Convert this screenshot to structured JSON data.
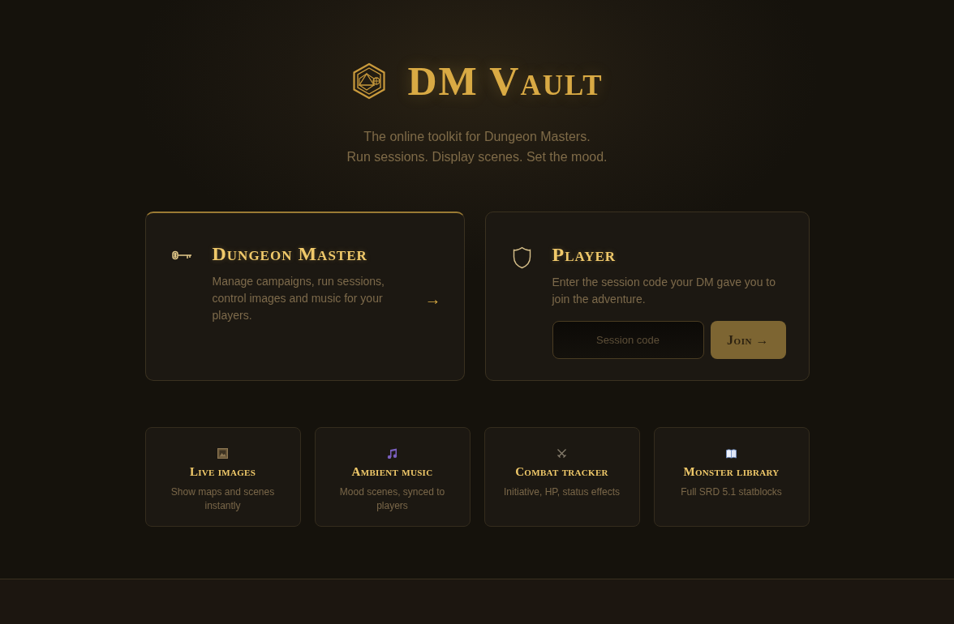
{
  "header": {
    "title": "DM Vault",
    "tagline": [
      "The online toolkit for Dungeon Masters.",
      "Run sessions. Display scenes. Set the mood."
    ]
  },
  "roles": [
    {
      "kind": "dm",
      "selected": true,
      "title": "Dungeon Master",
      "description": "Manage campaigns, run sessions, control images and music for your players.",
      "arrow": "→"
    },
    {
      "kind": "player",
      "selected": false,
      "title": "Player",
      "description": "Enter the session code your DM gave you to join the adventure.",
      "session_field": {
        "placeholder": "Session code"
      },
      "button": "Join →"
    }
  ],
  "features": [
    {
      "title": "Live images",
      "description": "Show maps and scenes instantly"
    },
    {
      "title": "Ambient music",
      "description": "Mood scenes, synced to players"
    },
    {
      "title": "Combat tracker",
      "description": "Initiative, HP, status effects"
    },
    {
      "title": "Monster library",
      "description": "Full SRD 5.1 statblocks"
    }
  ]
}
